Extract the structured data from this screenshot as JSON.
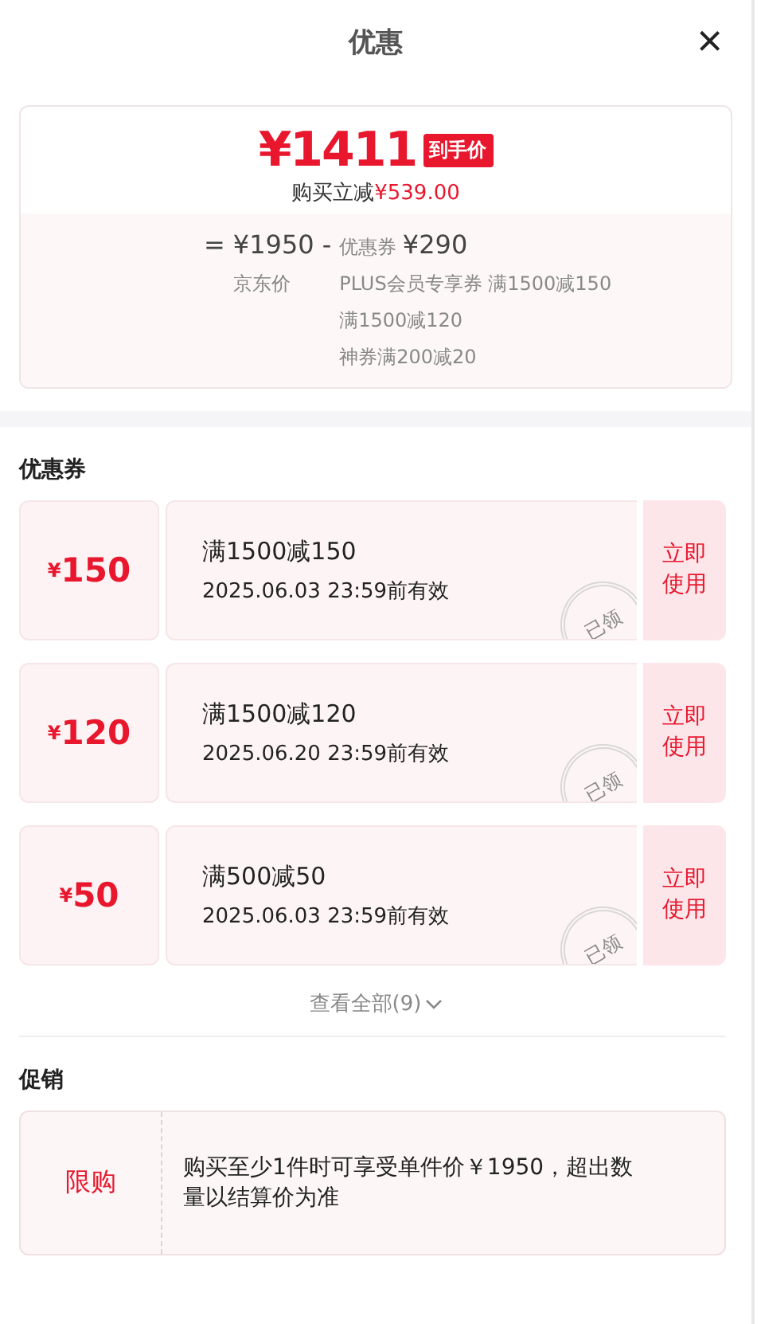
{
  "header": {
    "title": "优惠",
    "close": "×"
  },
  "summary": {
    "final_price": "¥1411",
    "final_tag": "到手价",
    "saving_label": "购买立减",
    "saving_amount": "¥539.00",
    "equals": "=",
    "base_price": "¥1950",
    "base_label": "京东价",
    "minus": "-",
    "coupon_label": "优惠券",
    "coupon_total": "¥290",
    "details": [
      "PLUS会员专享券 满1500减150",
      "满1500减120",
      "神券满200减20"
    ]
  },
  "coupons_section": {
    "title": "优惠券",
    "coupons": [
      {
        "currency": "¥",
        "amount": "150",
        "condition": "满1500减150",
        "expiry": "2025.06.03 23:59前有效",
        "stamp": "已领",
        "action": "立即使用"
      },
      {
        "currency": "¥",
        "amount": "120",
        "condition": "满1500减120",
        "expiry": "2025.06.20 23:59前有效",
        "stamp": "已领",
        "action": "立即使用"
      },
      {
        "currency": "¥",
        "amount": "50",
        "condition": "满500减50",
        "expiry": "2025.06.03 23:59前有效",
        "stamp": "已领",
        "action": "立即使用"
      }
    ],
    "view_all": "查看全部(9)"
  },
  "promotion_section": {
    "title": "促销",
    "promotions": [
      {
        "tag": "限购",
        "text": "购买至少1件时可享受单件价￥1950，超出数量以结算价为准"
      }
    ]
  }
}
